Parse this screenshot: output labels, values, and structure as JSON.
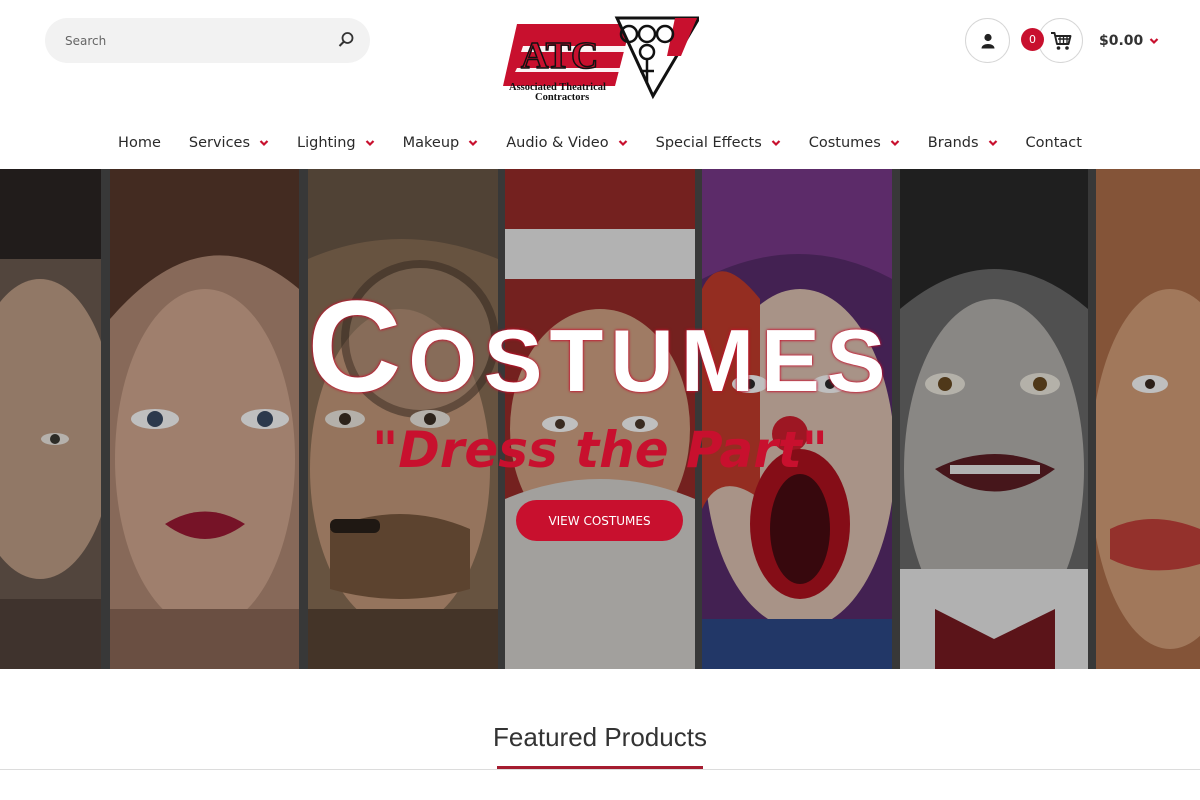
{
  "header": {
    "search": {
      "placeholder": "Search",
      "value": ""
    },
    "logo": {
      "letters": "ATC",
      "line1": "Associated Theatrical",
      "line2": "Contractors"
    },
    "cart": {
      "count": "0",
      "total": "$0.00"
    }
  },
  "nav": {
    "items": [
      {
        "label": "Home",
        "has_dropdown": false
      },
      {
        "label": "Services",
        "has_dropdown": true
      },
      {
        "label": "Lighting",
        "has_dropdown": true
      },
      {
        "label": "Makeup",
        "has_dropdown": true
      },
      {
        "label": "Audio & Video",
        "has_dropdown": true
      },
      {
        "label": "Special Effects",
        "has_dropdown": true
      },
      {
        "label": "Costumes",
        "has_dropdown": true
      },
      {
        "label": "Brands",
        "has_dropdown": true
      },
      {
        "label": "Contact",
        "has_dropdown": false
      }
    ]
  },
  "hero": {
    "title_first": "C",
    "title_rest": "OSTUMES",
    "tagline": "\"Dress the Part\"",
    "button_label": "VIEW COSTUMES"
  },
  "featured": {
    "title": "Featured Products"
  },
  "colors": {
    "accent": "#c8102e",
    "underline": "#a51c30",
    "search_bg": "#f2f2f2"
  },
  "icons": [
    "search-icon",
    "user-icon",
    "cart-icon",
    "chevron-down-icon"
  ]
}
